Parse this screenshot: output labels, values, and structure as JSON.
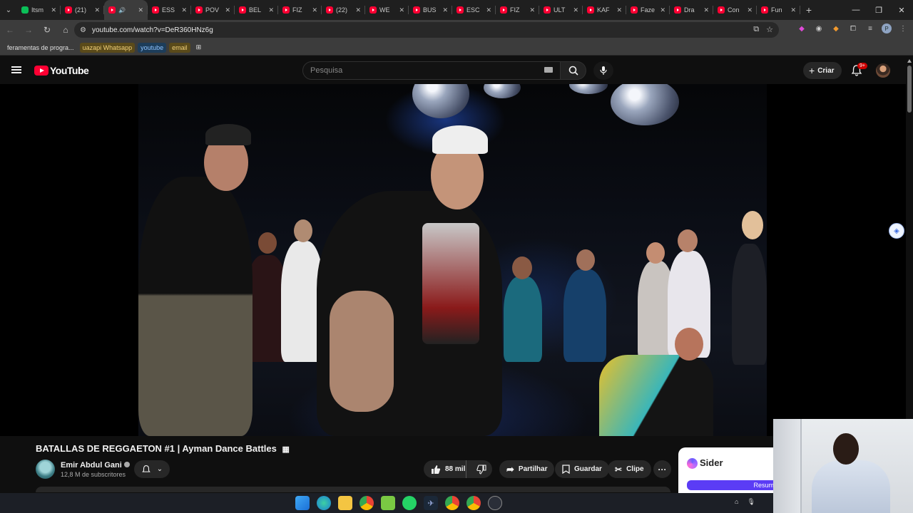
{
  "browser": {
    "tabs": [
      {
        "label": "Itsm",
        "icon": "green"
      },
      {
        "label": "(21)",
        "icon": "yt"
      },
      {
        "label": "",
        "icon": "yt",
        "active": true
      },
      {
        "label": "ESS",
        "icon": "yt"
      },
      {
        "label": "POV",
        "icon": "yt"
      },
      {
        "label": "BEL",
        "icon": "yt"
      },
      {
        "label": "FIZ",
        "icon": "yt"
      },
      {
        "label": "(22)",
        "icon": "yt"
      },
      {
        "label": "WE",
        "icon": "yt"
      },
      {
        "label": "BUS",
        "icon": "yt"
      },
      {
        "label": "ESC",
        "icon": "yt"
      },
      {
        "label": "FIZ",
        "icon": "yt"
      },
      {
        "label": "ULT",
        "icon": "yt"
      },
      {
        "label": "KAF",
        "icon": "yt"
      },
      {
        "label": "Faze",
        "icon": "yt"
      },
      {
        "label": "Dra",
        "icon": "yt"
      },
      {
        "label": "Con",
        "icon": "yt"
      },
      {
        "label": "Fun",
        "icon": "yt"
      }
    ],
    "url": "youtube.com/watch?v=DeR360HNz6g",
    "bookmarks": [
      {
        "label": "feramentas de progra...",
        "bg": "",
        "color": "#e0e0e0"
      },
      {
        "label": "uazapi Whatsapp",
        "bg": "#5a4a1a",
        "color": "#f3d27a"
      },
      {
        "label": "youtube",
        "bg": "#1d3d5a",
        "color": "#8fc3ff"
      },
      {
        "label": "email",
        "bg": "#5a4a1a",
        "color": "#f3d27a"
      }
    ]
  },
  "youtube": {
    "logo_text": "YouTube",
    "search_placeholder": "Pesquisa",
    "create_label": "Criar",
    "notif_badge": "9+",
    "video_title": "BATALLAS DE REGGAETON #1 | Ayman Dance Battles",
    "channel_name": "Emir Abdul Gani",
    "subscribers": "12,8 M de subscritores",
    "likes": "88 mil",
    "share_label": "Partilhar",
    "save_label": "Guardar",
    "clip_label": "Clipe"
  },
  "sider": {
    "name": "Sider",
    "button": "Resum"
  },
  "colors": {
    "yt_red": "#ff0033",
    "background": "#0f0f0f",
    "pill": "#272727"
  }
}
